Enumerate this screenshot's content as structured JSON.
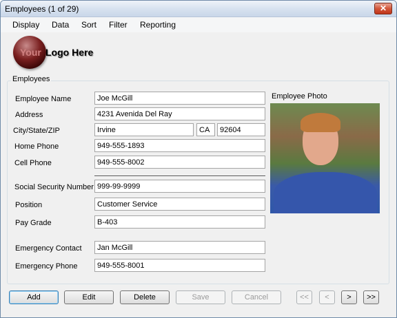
{
  "window": {
    "title": "Employees  (1 of 29)",
    "close_glyph": "✕"
  },
  "menu": [
    "Display",
    "Data",
    "Sort",
    "Filter",
    "Reporting"
  ],
  "logo": {
    "text_your": "Your",
    "text_rest": "Logo Here"
  },
  "group": {
    "label": "Employees"
  },
  "labels": {
    "employee_name": "Employee Name",
    "address": "Address",
    "city_state_zip": "City/State/ZIP",
    "home_phone": "Home Phone",
    "cell_phone": "Cell Phone",
    "ssn": "Social Security Number",
    "position": "Position",
    "pay_grade": "Pay Grade",
    "emergency_contact": "Emergency Contact",
    "emergency_phone": "Emergency Phone",
    "photo": "Employee Photo"
  },
  "values": {
    "employee_name": "Joe McGill",
    "address": "4231 Avenida Del Ray",
    "city": "Irvine",
    "state": "CA",
    "zip": "92604",
    "home_phone": "949-555-1893",
    "cell_phone": "949-555-8002",
    "ssn": "999-99-9999",
    "position": "Customer Service",
    "pay_grade": "B-403",
    "emergency_contact": "Jan McGill",
    "emergency_phone": "949-555-8001"
  },
  "buttons": {
    "add": "Add",
    "edit": "Edit",
    "delete": "Delete",
    "save": "Save",
    "cancel": "Cancel"
  },
  "nav": {
    "first": "<<",
    "prev": "<",
    "next": ">",
    "last": ">>"
  }
}
